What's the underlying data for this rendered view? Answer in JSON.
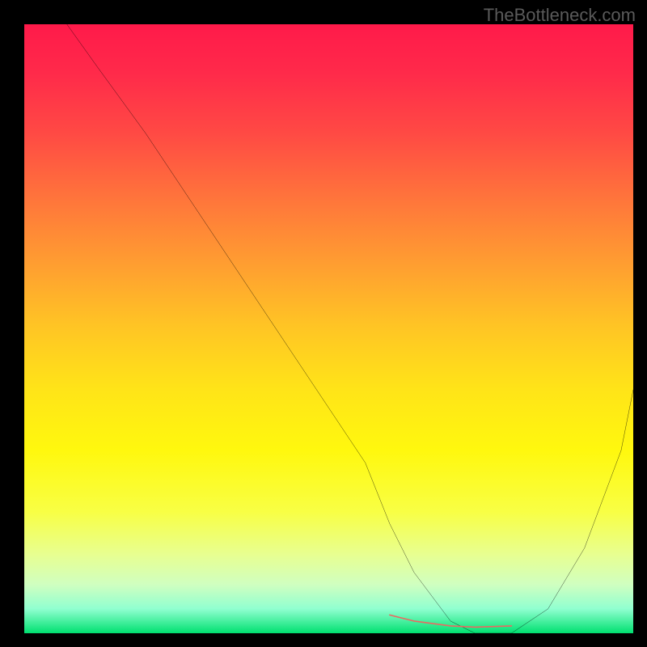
{
  "watermark": "TheBottleneck.com",
  "chart_data": {
    "type": "line",
    "title": "",
    "xlabel": "",
    "ylabel": "",
    "xlim": [
      0,
      100
    ],
    "ylim": [
      0,
      100
    ],
    "curve": {
      "x": [
        7,
        12,
        20,
        30,
        40,
        50,
        56,
        60,
        64,
        70,
        74,
        80,
        86,
        92,
        98,
        100
      ],
      "y": [
        100,
        93,
        82,
        67,
        52,
        37,
        28,
        18,
        10,
        2,
        0,
        0,
        4,
        14,
        30,
        40
      ]
    },
    "highlight_segment": {
      "x": [
        60,
        64,
        70,
        74,
        80
      ],
      "y": [
        3,
        2,
        1.2,
        1,
        1.2
      ]
    },
    "gradient_stops": [
      {
        "pos": 0,
        "color": "#ff1a4a"
      },
      {
        "pos": 18,
        "color": "#ff4a44"
      },
      {
        "pos": 40,
        "color": "#ffa030"
      },
      {
        "pos": 60,
        "color": "#ffe418"
      },
      {
        "pos": 80,
        "color": "#f8ff44"
      },
      {
        "pos": 96,
        "color": "#90ffd0"
      },
      {
        "pos": 100,
        "color": "#00e070"
      }
    ]
  }
}
